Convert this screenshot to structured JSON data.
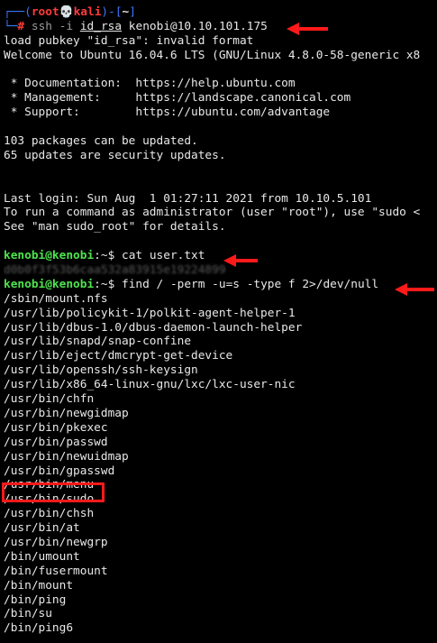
{
  "prompt": {
    "corner_top": "┌──(",
    "user": "root",
    "skull": "💀",
    "host": "kali",
    "mid": ")-[",
    "cwd": "~",
    "end": "]",
    "corner_bottom": "└─",
    "hash": "#"
  },
  "ssh": {
    "cmd": "ssh",
    "flag": "-i",
    "keyfile": "id_rsa",
    "target": "kenobi@10.10.101.175"
  },
  "output1": [
    "load pubkey \"id_rsa\": invalid format",
    "Welcome to Ubuntu 16.04.6 LTS (GNU/Linux 4.8.0-58-generic x8"
  ],
  "output2": [
    " * Documentation:  https://help.ubuntu.com",
    " * Management:     https://landscape.canonical.com",
    " * Support:        https://ubuntu.com/advantage"
  ],
  "output3": [
    "103 packages can be updated.",
    "65 updates are security updates."
  ],
  "output4": [
    "Last login: Sun Aug  1 01:27:11 2021 from 10.10.5.101",
    "To run a command as administrator (user \"root\"), use \"sudo <",
    "See \"man sudo_root\" for details."
  ],
  "kenobi_prompt": {
    "user_host": "kenobi@kenobi",
    "sep": ":~$"
  },
  "cmd_cat": "cat user.txt",
  "flag_redacted": "d0b0f3f53b6caa532a83915e19224899",
  "cmd_find": "find / -perm -u=s -type f 2>/dev/null",
  "suid_list": [
    "/sbin/mount.nfs",
    "/usr/lib/policykit-1/polkit-agent-helper-1",
    "/usr/lib/dbus-1.0/dbus-daemon-launch-helper",
    "/usr/lib/snapd/snap-confine",
    "/usr/lib/eject/dmcrypt-get-device",
    "/usr/lib/openssh/ssh-keysign",
    "/usr/lib/x86_64-linux-gnu/lxc/lxc-user-nic",
    "/usr/bin/chfn",
    "/usr/bin/newgidmap",
    "/usr/bin/pkexec",
    "/usr/bin/passwd",
    "/usr/bin/newuidmap",
    "/usr/bin/gpasswd",
    "/usr/bin/menu",
    "/usr/bin/sudo",
    "/usr/bin/chsh",
    "/usr/bin/at",
    "/usr/bin/newgrp",
    "/bin/umount",
    "/bin/fusermount",
    "/bin/mount",
    "/bin/ping",
    "/bin/su",
    "/bin/ping6"
  ],
  "colors": {
    "background": "#000000",
    "prompt_blue": "#3b78ff",
    "root_red": "#ff3b3b",
    "user_green": "#4ee44e",
    "annotation_red": "#ff1a1a"
  }
}
